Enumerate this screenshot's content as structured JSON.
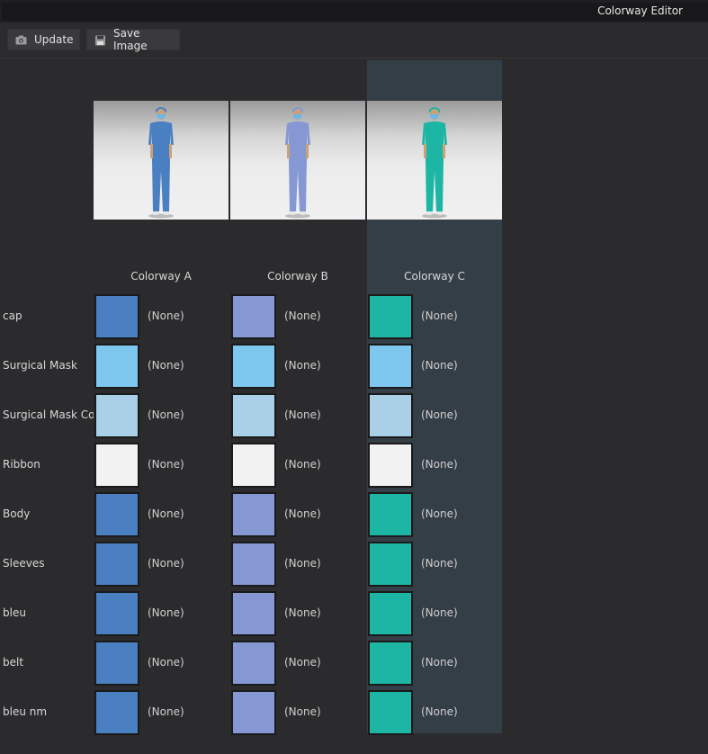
{
  "window": {
    "title": "Colorway Editor"
  },
  "toolbar": {
    "update_label": "Update",
    "save_label": "Save Image"
  },
  "colorways": [
    {
      "name": "Colorway A",
      "accent": "#4a7fc1"
    },
    {
      "name": "Colorway B",
      "accent": "#8598d4"
    },
    {
      "name": "Colorway C",
      "accent": "#1db5a3"
    }
  ],
  "selected_colorway": "Colorway C",
  "rows": [
    {
      "label": "cap",
      "colors": [
        "#4a7fc1",
        "#8598d4",
        "#1db5a3"
      ]
    },
    {
      "label": "Surgical Mask",
      "colors": [
        "#7ec8f0",
        "#7ec8f0",
        "#7ec8f0"
      ]
    },
    {
      "label": "Surgical Mask Copy",
      "colors": [
        "#a9d0e6",
        "#a9d0e6",
        "#a9d0e6"
      ]
    },
    {
      "label": "Ribbon",
      "colors": [
        "#f2f2f2",
        "#f2f2f2",
        "#f2f2f2"
      ]
    },
    {
      "label": "Body",
      "colors": [
        "#4a7fc1",
        "#8598d4",
        "#1db5a3"
      ]
    },
    {
      "label": "Sleeves",
      "colors": [
        "#4a7fc1",
        "#8598d4",
        "#1db5a3"
      ]
    },
    {
      "label": "bleu",
      "colors": [
        "#4a7fc1",
        "#8598d4",
        "#1db5a3"
      ]
    },
    {
      "label": "belt",
      "colors": [
        "#4a7fc1",
        "#8598d4",
        "#1db5a3"
      ]
    },
    {
      "label": "bleu nm",
      "colors": [
        "#4a7fc1",
        "#8598d4",
        "#1db5a3"
      ]
    }
  ],
  "swatch_value": "(None)",
  "icons": {
    "update": "camera-icon",
    "save": "floppy-disk-icon"
  }
}
